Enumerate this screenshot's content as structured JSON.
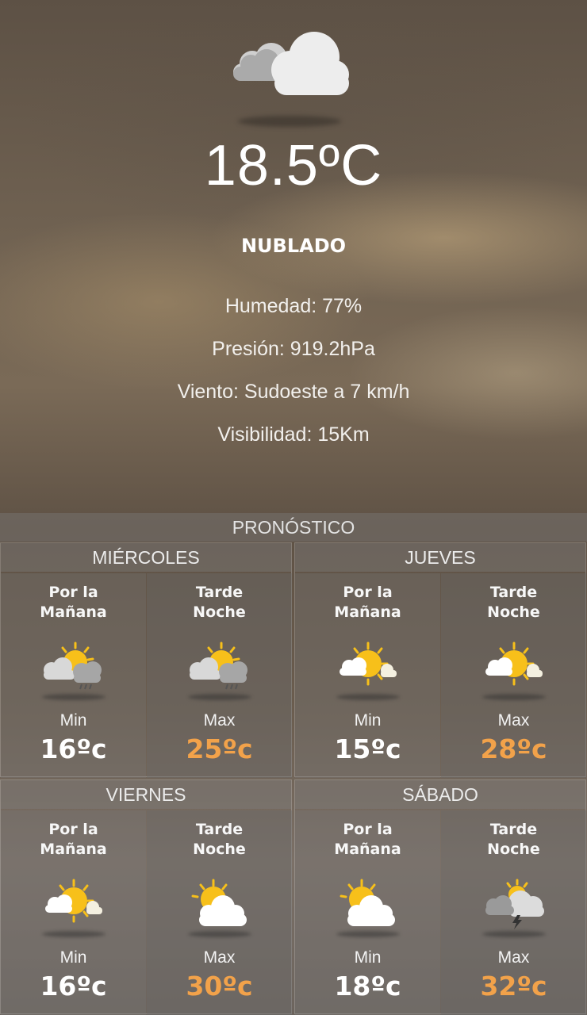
{
  "current": {
    "icon": "cloudy-icon",
    "temperature": "18.5ºC",
    "condition": "NUBLADO",
    "humidity": "Humedad: 77%",
    "pressure": "Presión: 919.2hPa",
    "wind": "Viento: Sudoeste a 7 km/h",
    "visibility": "Visibilidad: 15Km"
  },
  "forecast_title": "PRONÓSTICO",
  "days": [
    {
      "name": "MIÉRCOLES",
      "am": {
        "label": "Por la\nMañana",
        "icon": "sun-cloud-rain-icon",
        "mlabel": "Min",
        "value": "16ºc"
      },
      "pm": {
        "label": "Tarde\nNoche",
        "icon": "sun-cloud-rain-icon",
        "mlabel": "Max",
        "value": "25ºc"
      }
    },
    {
      "name": "JUEVES",
      "am": {
        "label": "Por la\nMañana",
        "icon": "sun-small-clouds-icon",
        "mlabel": "Min",
        "value": "15ºc"
      },
      "pm": {
        "label": "Tarde\nNoche",
        "icon": "sun-small-clouds-icon",
        "mlabel": "Max",
        "value": "28ºc"
      }
    },
    {
      "name": "VIERNES",
      "am": {
        "label": "Por la\nMañana",
        "icon": "sun-small-clouds-icon",
        "mlabel": "Min",
        "value": "16ºc"
      },
      "pm": {
        "label": "Tarde\nNoche",
        "icon": "partly-cloudy-icon",
        "mlabel": "Max",
        "value": "30ºc"
      }
    },
    {
      "name": "SÁBADO",
      "am": {
        "label": "Por la\nMañana",
        "icon": "partly-cloudy-icon",
        "mlabel": "Min",
        "value": "18ºc"
      },
      "pm": {
        "label": "Tarde\nNoche",
        "icon": "thunderstorm-icon",
        "mlabel": "Max",
        "value": "32ºc"
      }
    }
  ],
  "colors": {
    "max_value": "#f2a24a",
    "sun": "#f7c01a",
    "cloud": "#ffffff"
  }
}
